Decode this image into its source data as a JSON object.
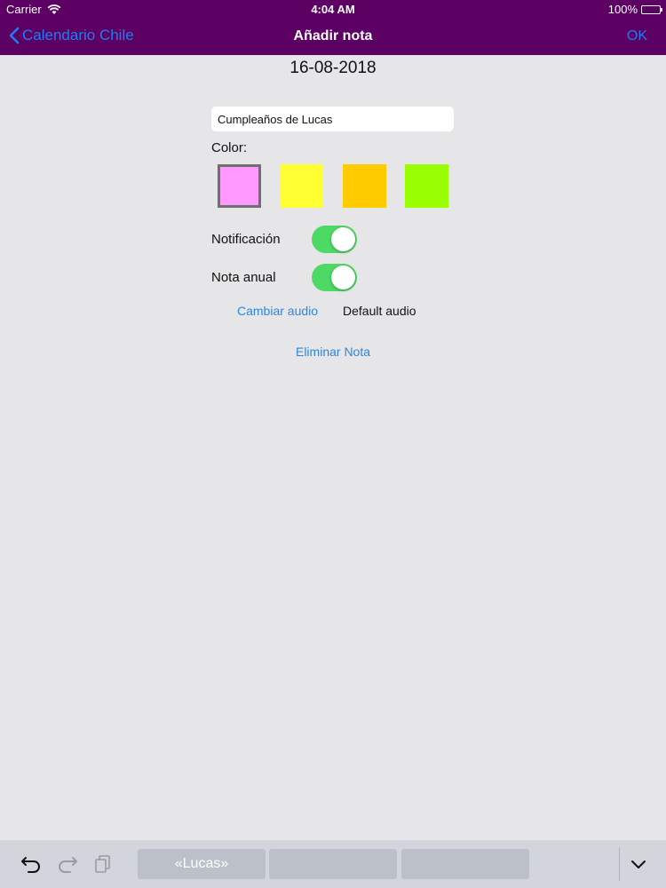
{
  "status_bar": {
    "carrier": "Carrier",
    "time": "4:04 AM",
    "battery": "100%"
  },
  "nav": {
    "back_label": "Calendario Chile",
    "title": "Añadir nota",
    "ok_label": "OK"
  },
  "note": {
    "date": "16-08-2018",
    "title_value": "Cumpleaños de Lucas",
    "color_label": "Color:",
    "colors": [
      "#ff99ff",
      "#ffff33",
      "#ffcc00",
      "#99ff00"
    ],
    "selected_color_index": 0,
    "notification_label": "Notificación",
    "notification_on": true,
    "annual_label": "Nota anual",
    "annual_on": true,
    "change_audio_label": "Cambiar audio",
    "audio_value": "Default audio",
    "delete_label": "Eliminar Nota"
  },
  "keyboard_bar": {
    "suggestions": [
      "«Lucas»",
      "",
      ""
    ],
    "icons": [
      "undo-icon",
      "redo-icon",
      "paste-icon",
      "chevron-down-icon"
    ]
  },
  "theme": {
    "nav_background": "#5c0064",
    "accent": "#1f7cf5",
    "toggle_on": "#4cd964",
    "page_background": "#e6e6e8"
  }
}
